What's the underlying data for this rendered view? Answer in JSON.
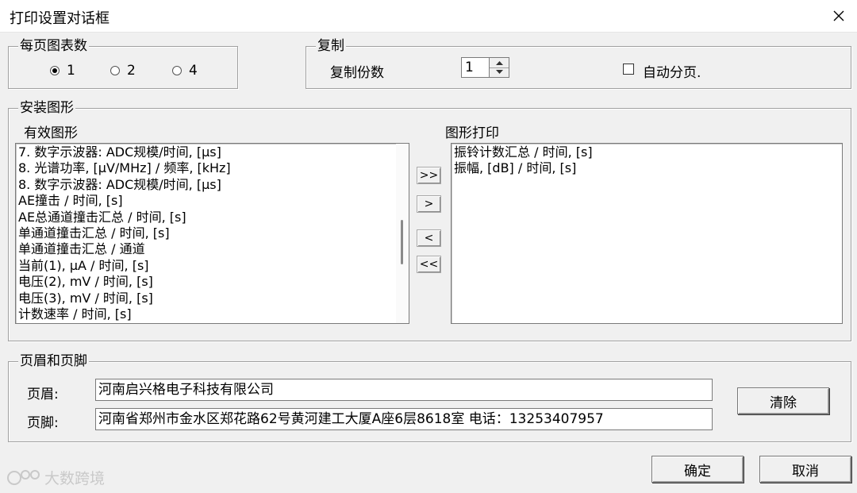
{
  "window": {
    "title": "打印设置对话框"
  },
  "charts_per_page": {
    "legend": "每页图表数",
    "options": [
      {
        "label": "1",
        "selected": true
      },
      {
        "label": "2",
        "selected": false
      },
      {
        "label": "4",
        "selected": false
      }
    ]
  },
  "copy": {
    "legend": "复制",
    "copies_label": "复制份数",
    "copies_value": "1",
    "auto_paging_label": "自动分页.",
    "auto_paging_checked": false
  },
  "install_graphs": {
    "legend": "安装图形",
    "available_label": "有效图形",
    "available_items": [
      "7. 数字示波器: ADC规模/时间, [μs]",
      "8. 光谱功率, [μV/MHz] / 频率, [kHz]",
      "8. 数字示波器: ADC规模/时间, [μs]",
      "AE撞击 / 时间, [s]",
      "AE总通道撞击汇总 / 时间, [s]",
      "单通道撞击汇总 / 时间, [s]",
      "单通道撞击汇总 / 通道",
      "当前(1), μA / 时间, [s]",
      "电压(2), mV / 时间, [s]",
      "电压(3), mV / 时间, [s]",
      "计数速率 / 时间, [s]"
    ],
    "print_label": "图形打印",
    "print_items": [
      "振铃计数汇总 / 时间, [s]",
      "振幅, [dB] / 时间, [s]"
    ],
    "buttons": {
      "add_all": ">>",
      "add": ">",
      "remove": "<",
      "remove_all": "<<"
    }
  },
  "header_footer": {
    "legend": "页眉和页脚",
    "header_label": "页眉:",
    "header_value": "河南启兴格电子科技有限公司",
    "footer_label": "页脚:",
    "footer_value": "河南省郑州市金水区郑花路62号黄河建工大厦A座6层8618室 电话：13253407957",
    "clear_label": "清除"
  },
  "actions": {
    "ok": "确定",
    "cancel": "取消"
  },
  "watermark": {
    "text": "大数跨境"
  },
  "icons": {
    "close": "close-icon",
    "spin_up": "chevron-up-icon",
    "spin_down": "chevron-down-icon"
  }
}
